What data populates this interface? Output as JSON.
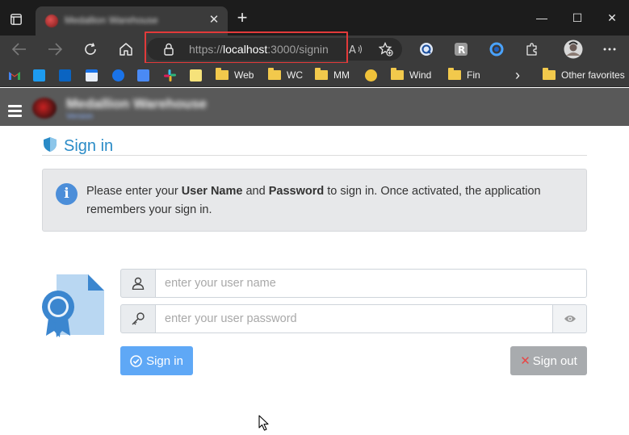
{
  "browser": {
    "tab": {
      "title": "Medallion Warehouse",
      "close": "✕"
    },
    "new_tab": "+",
    "window_controls": {
      "minimize": "—",
      "maximize": "☐",
      "close": "✕"
    },
    "address": {
      "scheme": "https://",
      "host": "localhost",
      "rest": ":3000/signin"
    },
    "bookmarks": [
      "Web",
      "WC",
      "MM",
      "Wind",
      "Fin"
    ],
    "other_favorites": "Other favorites",
    "more_bookmarks": "›"
  },
  "app": {
    "name": "Medallion Warehouse",
    "subtitle": "Version"
  },
  "page": {
    "title": "Sign in",
    "info": {
      "p1": "Please enter your ",
      "b1": "User Name",
      "p2": " and ",
      "b2": "Password",
      "p3": " to sign in. Once activated, the application remembers your sign in."
    },
    "username": {
      "placeholder": "enter your user name",
      "value": ""
    },
    "password": {
      "placeholder": "enter your user password",
      "value": ""
    },
    "signin_label": "Sign in",
    "signout_label": "Sign out"
  },
  "colors": {
    "accent": "#2a8bc7",
    "signin_button": "#5fa8f6",
    "signout_button": "#a8abae",
    "address_highlight": "#e23a3a",
    "app_header": "#595959"
  },
  "icons": {
    "tab_actions": "tab-actions-icon",
    "back": "back-arrow-icon",
    "forward": "forward-arrow-icon",
    "refresh": "refresh-icon",
    "home": "home-icon",
    "lock": "lock-icon",
    "read_aloud": "read-aloud-icon",
    "add_favorite": "add-favorite-icon",
    "extensions": "puzzle-icon",
    "more": "more-icon",
    "user": "user-icon",
    "key": "key-icon",
    "eye": "eye-icon",
    "certificate": "certificate-icon",
    "info": "info-icon",
    "shield": "shield-icon"
  }
}
